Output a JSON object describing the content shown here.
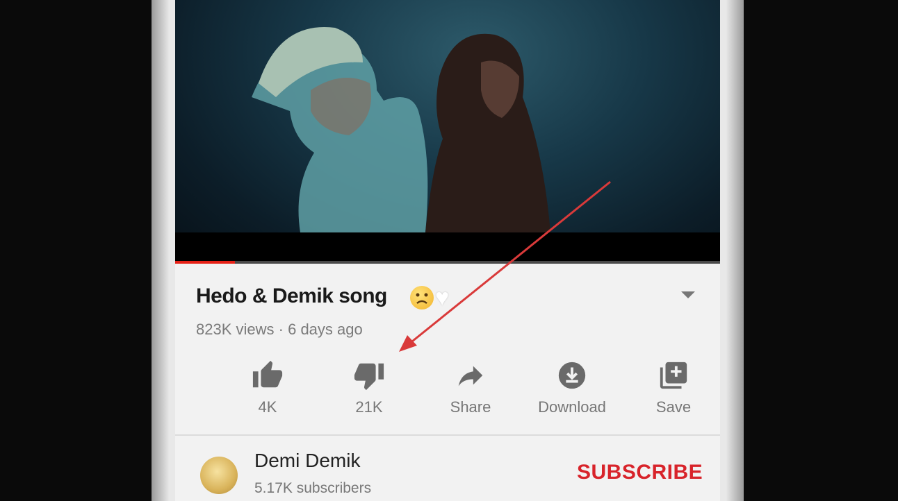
{
  "video": {
    "title": "Hedo & Demik song",
    "emojis": [
      "sad-face-emoji",
      "white-heart-emoji"
    ],
    "views": "823K views",
    "separator": "·",
    "age": "6 days ago",
    "progress_fraction": 0.11
  },
  "actions": [
    {
      "icon": "thumbs-up-icon",
      "label": "4K"
    },
    {
      "icon": "thumbs-down-icon",
      "label": "21K"
    },
    {
      "icon": "share-icon",
      "label": "Share"
    },
    {
      "icon": "download-icon",
      "label": "Download"
    },
    {
      "icon": "save-icon",
      "label": "Save"
    }
  ],
  "channel": {
    "name": "Demi Demik",
    "subscribers": "5.17K subscribers",
    "subscribe_label": "SUBSCRIBE"
  },
  "colors": {
    "accent": "#d8232a",
    "progress": "#e62117",
    "annotation_arrow": "#d93a3a"
  }
}
